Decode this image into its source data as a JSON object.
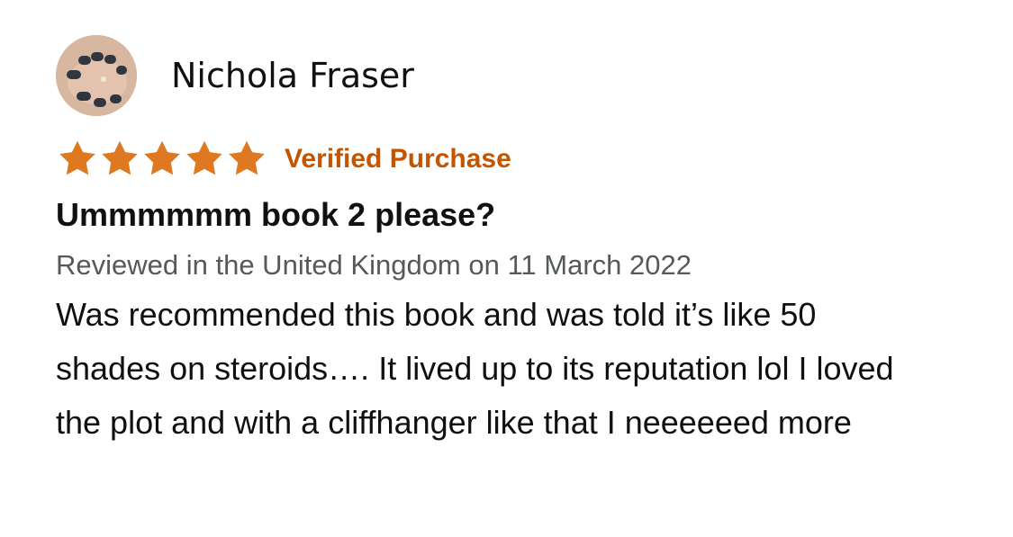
{
  "review": {
    "reviewer_name": "Nichola Fraser",
    "avatar_icon": "profile-photo",
    "rating": 5,
    "rating_max": 5,
    "star_color": "#de7921",
    "badge": "Verified Purchase",
    "badge_color": "#c45500",
    "title": "Ummmmmm book 2 please?",
    "reviewed_line": "Reviewed in the United Kingdom on 11 March 2022",
    "body": "Was recommended this book and was told it’s like 50 shades on steroids…. It lived up to its reputation lol I loved the plot and with a cliffhanger like that I neeeeeed more"
  }
}
